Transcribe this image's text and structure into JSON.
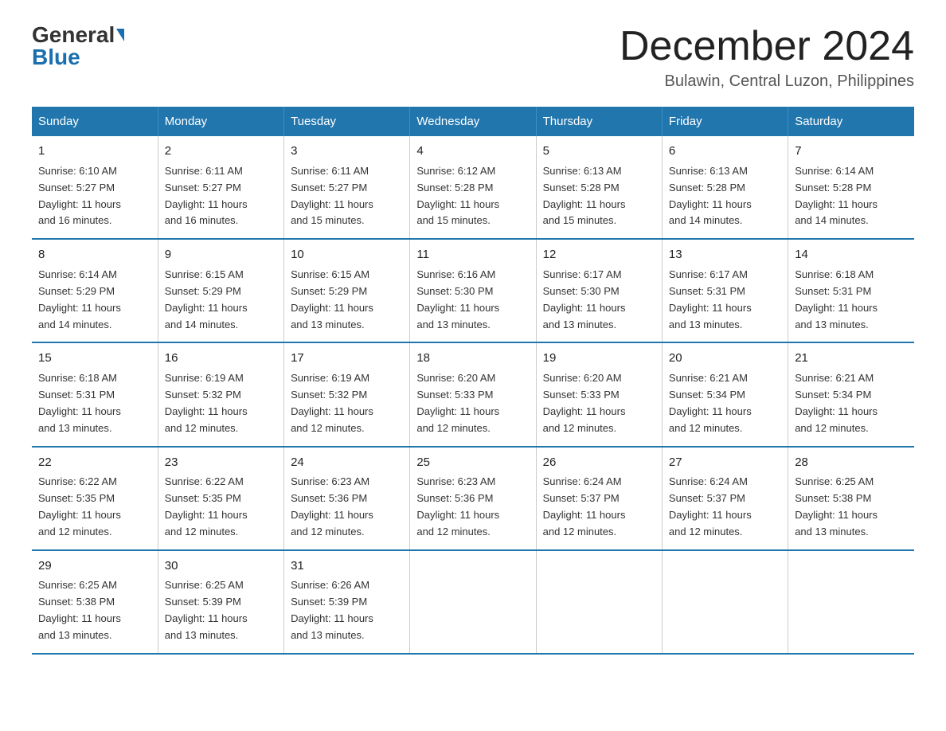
{
  "header": {
    "logo_general": "General",
    "logo_blue": "Blue",
    "month_title": "December 2024",
    "location": "Bulawin, Central Luzon, Philippines"
  },
  "days_of_week": [
    "Sunday",
    "Monday",
    "Tuesday",
    "Wednesday",
    "Thursday",
    "Friday",
    "Saturday"
  ],
  "weeks": [
    [
      {
        "day": "1",
        "sunrise": "6:10 AM",
        "sunset": "5:27 PM",
        "daylight": "11 hours and 16 minutes."
      },
      {
        "day": "2",
        "sunrise": "6:11 AM",
        "sunset": "5:27 PM",
        "daylight": "11 hours and 16 minutes."
      },
      {
        "day": "3",
        "sunrise": "6:11 AM",
        "sunset": "5:27 PM",
        "daylight": "11 hours and 15 minutes."
      },
      {
        "day": "4",
        "sunrise": "6:12 AM",
        "sunset": "5:28 PM",
        "daylight": "11 hours and 15 minutes."
      },
      {
        "day": "5",
        "sunrise": "6:13 AM",
        "sunset": "5:28 PM",
        "daylight": "11 hours and 15 minutes."
      },
      {
        "day": "6",
        "sunrise": "6:13 AM",
        "sunset": "5:28 PM",
        "daylight": "11 hours and 14 minutes."
      },
      {
        "day": "7",
        "sunrise": "6:14 AM",
        "sunset": "5:28 PM",
        "daylight": "11 hours and 14 minutes."
      }
    ],
    [
      {
        "day": "8",
        "sunrise": "6:14 AM",
        "sunset": "5:29 PM",
        "daylight": "11 hours and 14 minutes."
      },
      {
        "day": "9",
        "sunrise": "6:15 AM",
        "sunset": "5:29 PM",
        "daylight": "11 hours and 14 minutes."
      },
      {
        "day": "10",
        "sunrise": "6:15 AM",
        "sunset": "5:29 PM",
        "daylight": "11 hours and 13 minutes."
      },
      {
        "day": "11",
        "sunrise": "6:16 AM",
        "sunset": "5:30 PM",
        "daylight": "11 hours and 13 minutes."
      },
      {
        "day": "12",
        "sunrise": "6:17 AM",
        "sunset": "5:30 PM",
        "daylight": "11 hours and 13 minutes."
      },
      {
        "day": "13",
        "sunrise": "6:17 AM",
        "sunset": "5:31 PM",
        "daylight": "11 hours and 13 minutes."
      },
      {
        "day": "14",
        "sunrise": "6:18 AM",
        "sunset": "5:31 PM",
        "daylight": "11 hours and 13 minutes."
      }
    ],
    [
      {
        "day": "15",
        "sunrise": "6:18 AM",
        "sunset": "5:31 PM",
        "daylight": "11 hours and 13 minutes."
      },
      {
        "day": "16",
        "sunrise": "6:19 AM",
        "sunset": "5:32 PM",
        "daylight": "11 hours and 12 minutes."
      },
      {
        "day": "17",
        "sunrise": "6:19 AM",
        "sunset": "5:32 PM",
        "daylight": "11 hours and 12 minutes."
      },
      {
        "day": "18",
        "sunrise": "6:20 AM",
        "sunset": "5:33 PM",
        "daylight": "11 hours and 12 minutes."
      },
      {
        "day": "19",
        "sunrise": "6:20 AM",
        "sunset": "5:33 PM",
        "daylight": "11 hours and 12 minutes."
      },
      {
        "day": "20",
        "sunrise": "6:21 AM",
        "sunset": "5:34 PM",
        "daylight": "11 hours and 12 minutes."
      },
      {
        "day": "21",
        "sunrise": "6:21 AM",
        "sunset": "5:34 PM",
        "daylight": "11 hours and 12 minutes."
      }
    ],
    [
      {
        "day": "22",
        "sunrise": "6:22 AM",
        "sunset": "5:35 PM",
        "daylight": "11 hours and 12 minutes."
      },
      {
        "day": "23",
        "sunrise": "6:22 AM",
        "sunset": "5:35 PM",
        "daylight": "11 hours and 12 minutes."
      },
      {
        "day": "24",
        "sunrise": "6:23 AM",
        "sunset": "5:36 PM",
        "daylight": "11 hours and 12 minutes."
      },
      {
        "day": "25",
        "sunrise": "6:23 AM",
        "sunset": "5:36 PM",
        "daylight": "11 hours and 12 minutes."
      },
      {
        "day": "26",
        "sunrise": "6:24 AM",
        "sunset": "5:37 PM",
        "daylight": "11 hours and 12 minutes."
      },
      {
        "day": "27",
        "sunrise": "6:24 AM",
        "sunset": "5:37 PM",
        "daylight": "11 hours and 12 minutes."
      },
      {
        "day": "28",
        "sunrise": "6:25 AM",
        "sunset": "5:38 PM",
        "daylight": "11 hours and 13 minutes."
      }
    ],
    [
      {
        "day": "29",
        "sunrise": "6:25 AM",
        "sunset": "5:38 PM",
        "daylight": "11 hours and 13 minutes."
      },
      {
        "day": "30",
        "sunrise": "6:25 AM",
        "sunset": "5:39 PM",
        "daylight": "11 hours and 13 minutes."
      },
      {
        "day": "31",
        "sunrise": "6:26 AM",
        "sunset": "5:39 PM",
        "daylight": "11 hours and 13 minutes."
      },
      null,
      null,
      null,
      null
    ]
  ],
  "labels": {
    "sunrise_prefix": "Sunrise: ",
    "sunset_prefix": "Sunset: ",
    "daylight_prefix": "Daylight: "
  }
}
